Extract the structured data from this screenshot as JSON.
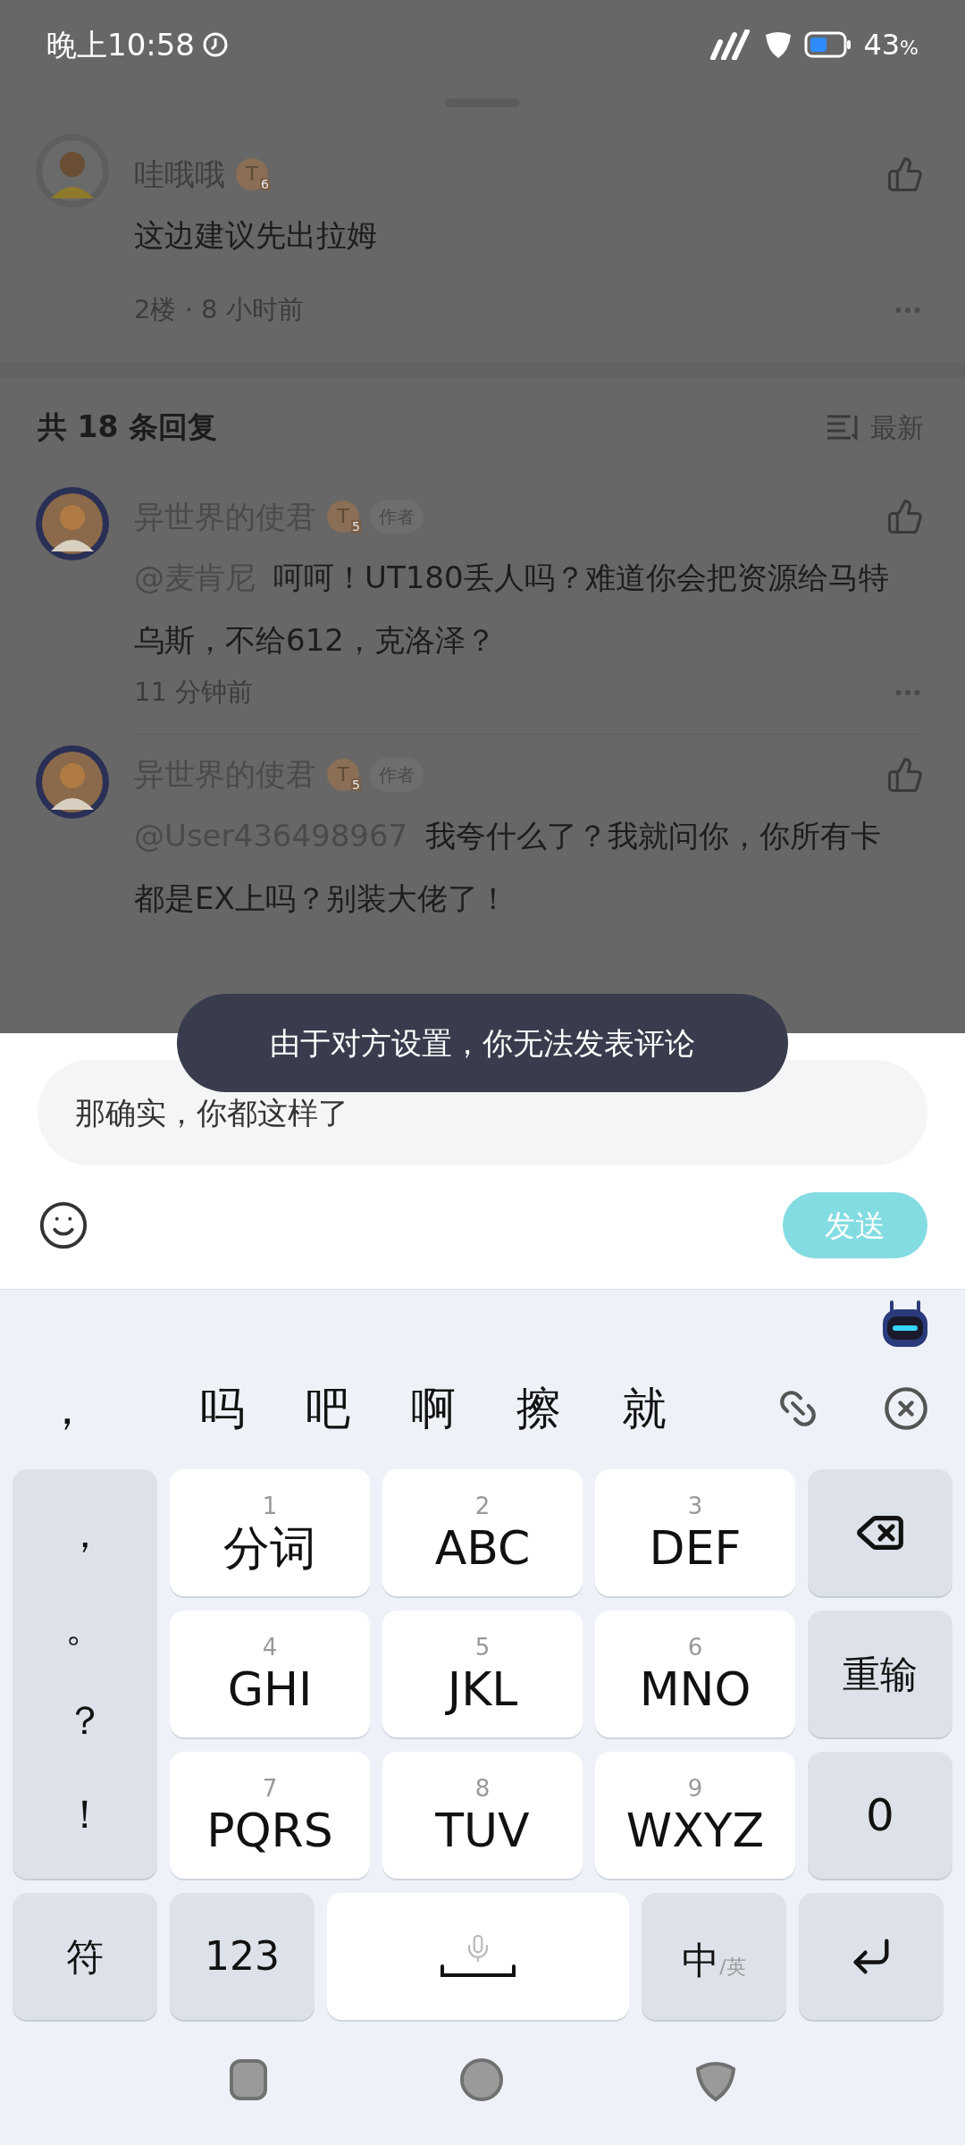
{
  "status_bar": {
    "time": "晚上10:58",
    "battery_percent": "43",
    "battery_unit": "%"
  },
  "comment": {
    "author": "哇哦哦",
    "badge_letter": "T",
    "badge_grade": "6",
    "text": "这边建议先出拉姆",
    "meta": "2楼 · 8 小时前"
  },
  "replies_header": {
    "title": "共 18 条回复",
    "sort": "最新"
  },
  "replies": [
    {
      "author": "异世界的使君",
      "badge_letter": "T",
      "badge_grade": "5",
      "tag": "作者",
      "mention": "@麦肯尼",
      "text": "呵呵！UT180丢人吗？难道你会把资源给马特乌斯，不给612，克洛泽？",
      "time": "11 分钟前"
    },
    {
      "author": "异世界的使君",
      "badge_letter": "T",
      "badge_grade": "5",
      "tag": "作者",
      "mention": "@User436498967",
      "text": "我夸什么了？我就问你，你所有卡都是EX上吗？别装大佬了！"
    }
  ],
  "toast": "由于对方设置，你无法发表评论",
  "comment_input": {
    "value": "那确实，你都这样了"
  },
  "send_button": {
    "label": "发送",
    "disabled": true
  },
  "keyboard": {
    "candidates": [
      "，",
      "吗",
      "吧",
      "啊",
      "擦",
      "就"
    ],
    "punctuation": [
      "，",
      "。",
      "？",
      "！"
    ],
    "keys": [
      {
        "digit": "1",
        "label": "分词"
      },
      {
        "digit": "2",
        "label": "ABC"
      },
      {
        "digit": "3",
        "label": "DEF"
      },
      {
        "digit": "4",
        "label": "GHI"
      },
      {
        "digit": "5",
        "label": "JKL"
      },
      {
        "digit": "6",
        "label": "MNO"
      },
      {
        "digit": "7",
        "label": "PQRS"
      },
      {
        "digit": "8",
        "label": "TUV"
      },
      {
        "digit": "9",
        "label": "WXYZ"
      }
    ],
    "reset_key": "重输",
    "zero_key": "0",
    "symbol_key": "符",
    "number_key": "123",
    "lang_main": "中",
    "lang_alt": "/英"
  }
}
